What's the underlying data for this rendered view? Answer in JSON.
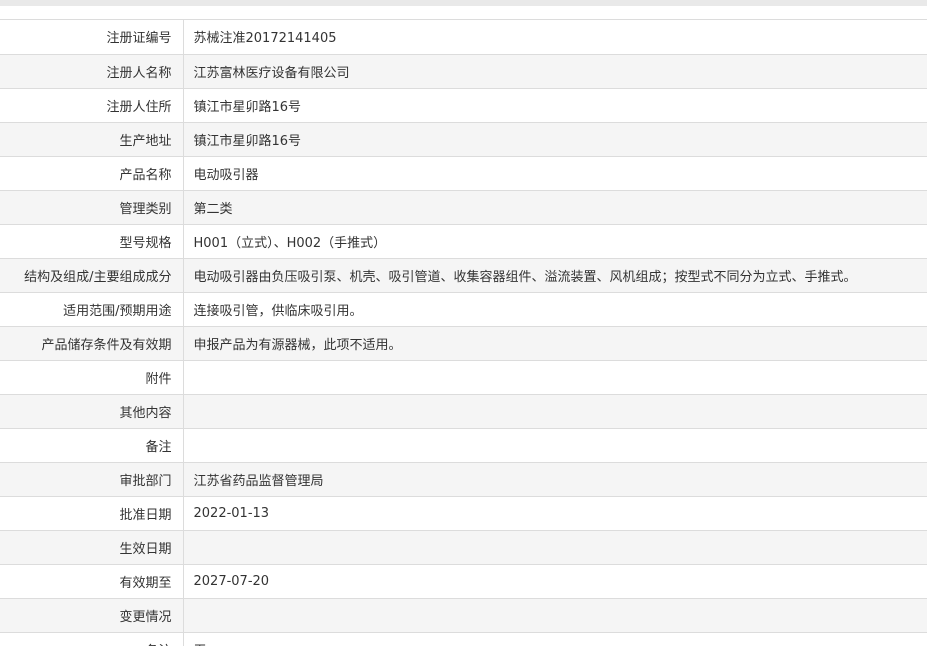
{
  "rows": [
    {
      "label": "注册证编号",
      "value": "苏械注准20172141405"
    },
    {
      "label": "注册人名称",
      "value": "江苏富林医疗设备有限公司"
    },
    {
      "label": "注册人住所",
      "value": "镇江市星卯路16号"
    },
    {
      "label": "生产地址",
      "value": "镇江市星卯路16号"
    },
    {
      "label": "产品名称",
      "value": "电动吸引器"
    },
    {
      "label": "管理类别",
      "value": "第二类"
    },
    {
      "label": "型号规格",
      "value": "H001（立式）、H002（手推式）"
    },
    {
      "label": "结构及组成/主要组成成分",
      "value": "电动吸引器由负压吸引泵、机壳、吸引管道、收集容器组件、溢流装置、风机组成；按型式不同分为立式、手推式。"
    },
    {
      "label": "适用范围/预期用途",
      "value": "连接吸引管，供临床吸引用。"
    },
    {
      "label": "产品储存条件及有效期",
      "value": "申报产品为有源器械，此项不适用。"
    },
    {
      "label": "附件",
      "value": ""
    },
    {
      "label": "其他内容",
      "value": ""
    },
    {
      "label": "备注",
      "value": ""
    },
    {
      "label": "审批部门",
      "value": "江苏省药品监督管理局"
    },
    {
      "label": "批准日期",
      "value": "2022-01-13"
    },
    {
      "label": "生效日期",
      "value": ""
    },
    {
      "label": "有效期至",
      "value": "2027-07-20"
    },
    {
      "label": "变更情况",
      "value": ""
    },
    {
      "label": "备注",
      "value": "无"
    }
  ]
}
